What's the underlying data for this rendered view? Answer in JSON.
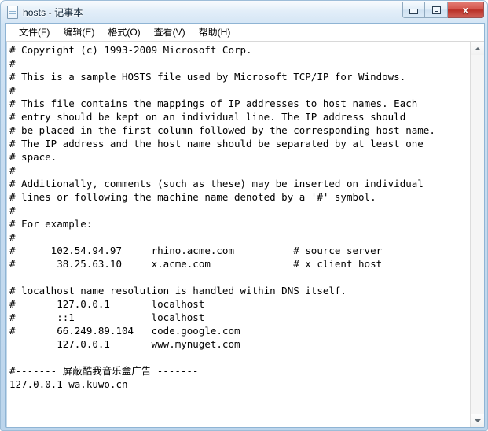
{
  "window": {
    "title": "hosts - 记事本",
    "icon": "notepad-document-icon",
    "controls": {
      "minimize_label": "",
      "maximize_label": "",
      "close_label": "x"
    },
    "accent_titlebar": "#c7dcf0",
    "accent_close": "#b92f26"
  },
  "menubar": {
    "items": [
      {
        "label": "文件(F)",
        "name": "menu-file"
      },
      {
        "label": "编辑(E)",
        "name": "menu-edit"
      },
      {
        "label": "格式(O)",
        "name": "menu-format"
      },
      {
        "label": "查看(V)",
        "name": "menu-view"
      },
      {
        "label": "帮助(H)",
        "name": "menu-help"
      }
    ]
  },
  "editor": {
    "lines": [
      "# Copyright (c) 1993-2009 Microsoft Corp.",
      "#",
      "# This is a sample HOSTS file used by Microsoft TCP/IP for Windows.",
      "#",
      "# This file contains the mappings of IP addresses to host names. Each",
      "# entry should be kept on an individual line. The IP address should",
      "# be placed in the first column followed by the corresponding host name.",
      "# The IP address and the host name should be separated by at least one",
      "# space.",
      "#",
      "# Additionally, comments (such as these) may be inserted on individual",
      "# lines or following the machine name denoted by a '#' symbol.",
      "#",
      "# For example:",
      "#",
      "#      102.54.94.97     rhino.acme.com          # source server",
      "#       38.25.63.10     x.acme.com              # x client host",
      "",
      "# localhost name resolution is handled within DNS itself.",
      "#       127.0.0.1       localhost",
      "#       ::1             localhost",
      "#       66.249.89.104   code.google.com",
      "        127.0.0.1       www.mynuget.com",
      "",
      "#------- 屏蔽酷我音乐盒广告 -------",
      "127.0.0.1 wa.kuwo.cn"
    ]
  },
  "scrollbar": {
    "up_arrow": "scroll-up-icon",
    "down_arrow": "scroll-down-icon"
  }
}
